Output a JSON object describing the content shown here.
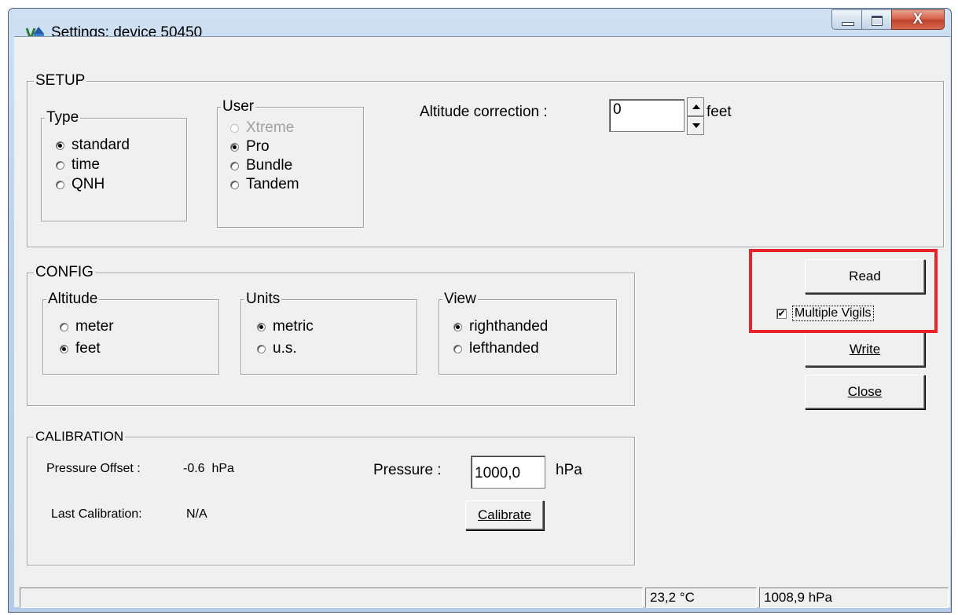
{
  "window": {
    "title": "Settings: device 50450",
    "close_glyph": "X",
    "icon": "app-logo-icon"
  },
  "setup": {
    "title": "SETUP",
    "type": {
      "title": "Type",
      "options": [
        "standard",
        "time",
        "QNH"
      ],
      "selected": "standard"
    },
    "user": {
      "title": "User",
      "options": [
        "Xtreme",
        "Pro",
        "Bundle",
        "Tandem"
      ],
      "disabled": [
        "Xtreme"
      ],
      "selected": "Pro"
    },
    "altitude_correction": {
      "label": "Altitude correction :",
      "value": "0",
      "unit": "feet"
    }
  },
  "config": {
    "title": "CONFIG",
    "altitude": {
      "title": "Altitude",
      "options": [
        "meter",
        "feet"
      ],
      "selected": "feet"
    },
    "units": {
      "title": "Units",
      "options": [
        "metric",
        "u.s."
      ],
      "selected": "metric"
    },
    "view": {
      "title": "View",
      "options": [
        "righthanded",
        "lefthanded"
      ],
      "selected": "righthanded"
    }
  },
  "calibration": {
    "title": "CALIBRATION",
    "pressure_offset_label": "Pressure Offset :",
    "pressure_offset_value": "-0.6  hPa",
    "last_calibration_label": "Last Calibration:",
    "last_calibration_value": "N/A",
    "pressure_label": "Pressure :",
    "pressure_value": "1000,0",
    "pressure_unit": "hPa",
    "calibrate_button": "Calibrate"
  },
  "buttons": {
    "read": "Read",
    "write": "Write",
    "close": "Close"
  },
  "multiple_vigils": {
    "label": "Multiple Vigils",
    "checked": true,
    "check_glyph": "✔"
  },
  "status_bar": {
    "temperature": "23,2 °C",
    "pressure": "1008,9 hPa"
  },
  "colors": {
    "highlight": "#e8232a",
    "face": "#f0f0f0",
    "title_bar": "#bcd3ec",
    "close_button": "#c0422c"
  }
}
